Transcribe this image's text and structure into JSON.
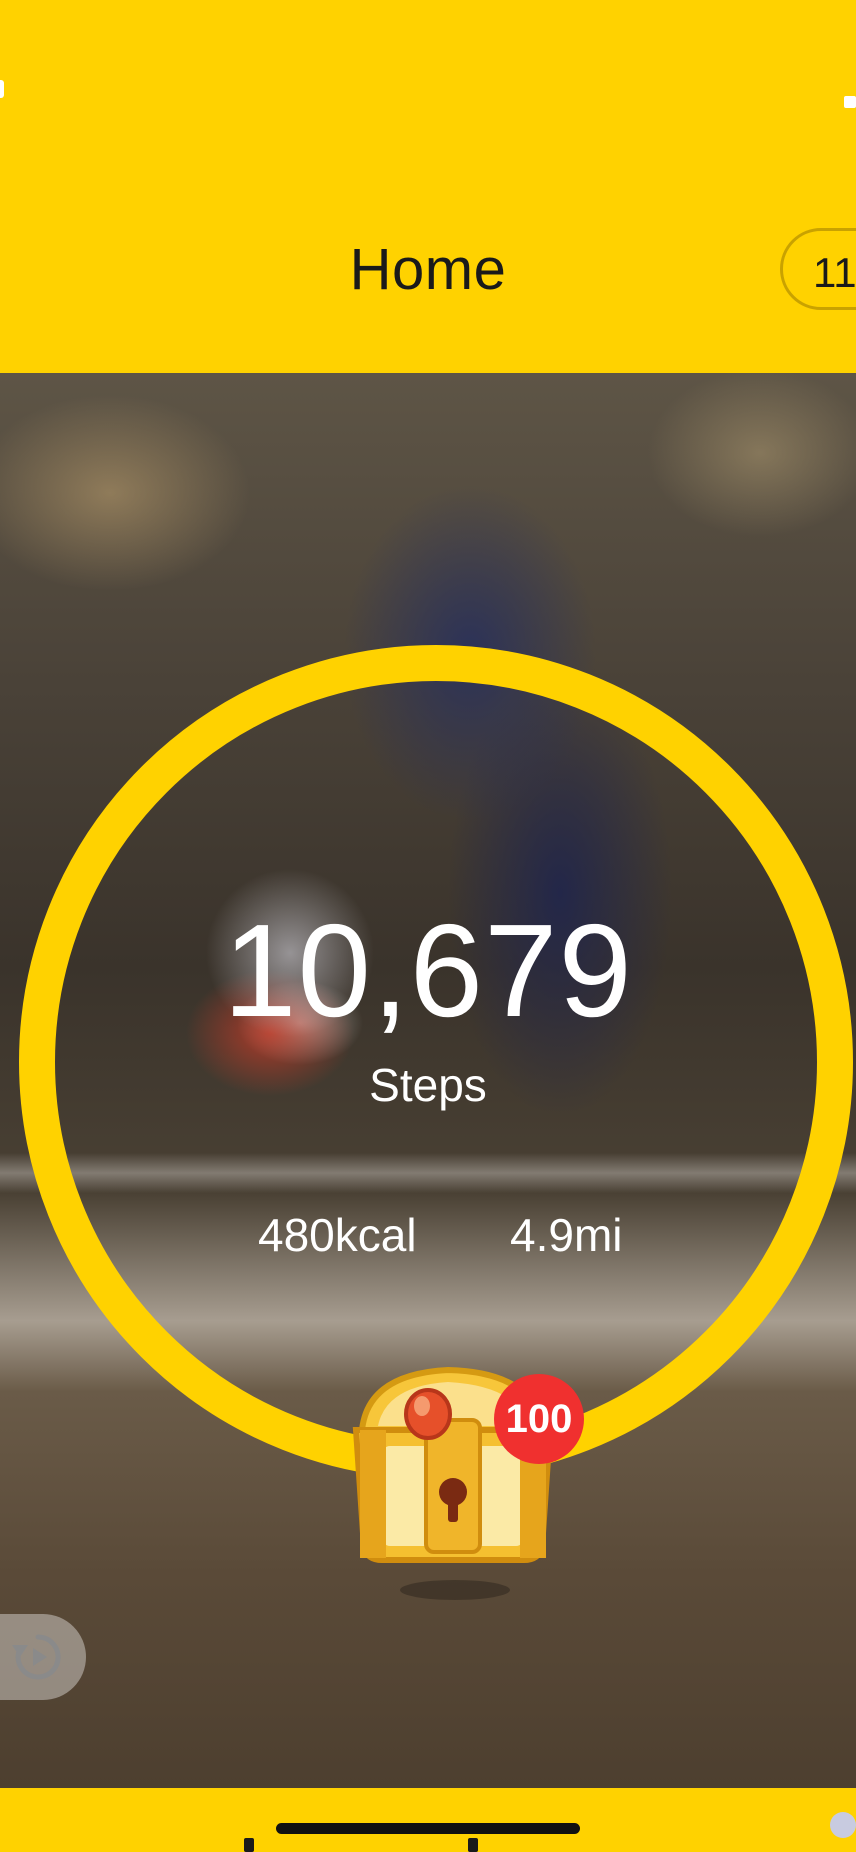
{
  "header": {
    "title": "Home",
    "coin_count": "11"
  },
  "activity": {
    "steps_value": "10,679",
    "steps_label": "Steps",
    "calories": "480kcal",
    "distance": "4.9mi"
  },
  "reward": {
    "chest_icon": "treasure-chest-icon",
    "badge_count": "100"
  },
  "controls": {
    "replay_icon": "replay-icon"
  },
  "colors": {
    "accent": "#FFD200",
    "badge": "#F0302F",
    "text_on_photo": "#FFFFFF",
    "title_text": "#1A1A1A"
  }
}
